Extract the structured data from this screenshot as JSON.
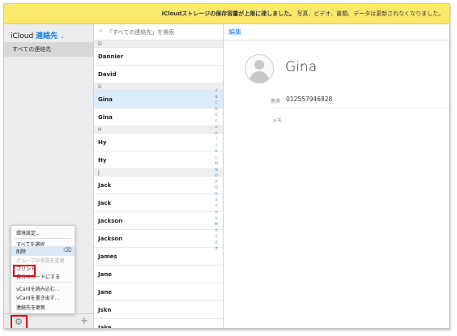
{
  "banner": {
    "bold_text": "iCloudストレージの保存容量が上限に達しました。",
    "text": "写真、ビデオ、書類、データは更新されなくなりました。"
  },
  "sidebar": {
    "app_name": "iCloud",
    "account_label": "連絡先",
    "chevron": "⌄",
    "group_all": "すべての連絡先",
    "gear_icon": "gear-icon",
    "plus_icon": "+"
  },
  "menu": {
    "items": [
      {
        "label": "環境設定..."
      },
      {
        "label": "すべてを選択"
      },
      {
        "label": "削除"
      },
      {
        "label": "グループの名前を変更"
      },
      {
        "label": "プリント"
      },
      {
        "label": "自分のカードにする"
      },
      {
        "label": "vCardを読み込む..."
      },
      {
        "label": "vCardを書き出す..."
      },
      {
        "label": "連絡先を更新"
      }
    ],
    "delete_key": "⌫"
  },
  "list": {
    "search_placeholder": "「すべての連絡先」を検索",
    "sections": [
      {
        "letter": "D",
        "names": [
          "Dannier",
          "David"
        ]
      },
      {
        "letter": "G",
        "names": [
          "Gina",
          "Gina"
        ]
      },
      {
        "letter": "H",
        "names": [
          "Hy",
          "Hy"
        ]
      },
      {
        "letter": "J",
        "names": [
          "Jack",
          "Jack",
          "Jackson",
          "Jackson",
          "James",
          "Jane",
          "Jane",
          "Jskn",
          "Jake"
        ]
      }
    ],
    "selected": "Gina",
    "index": [
      "A",
      "B",
      "C",
      "D",
      "E",
      "F",
      "G",
      "H",
      "I",
      "J",
      "K",
      "L",
      "M",
      "N",
      "O",
      "P",
      "Q",
      "R",
      "S",
      "T",
      "U",
      "V",
      "W",
      "X",
      "Y",
      "Z",
      "#"
    ]
  },
  "detail": {
    "edit": "編集",
    "name": "Gina",
    "phone_label": "携帯",
    "phone": "012557946828",
    "memo_label": "メモ"
  },
  "colors": {
    "banner": "#fbe96c",
    "accent": "#1a7ee8",
    "highlight": "#e60012",
    "selection": "#dcebfa"
  }
}
